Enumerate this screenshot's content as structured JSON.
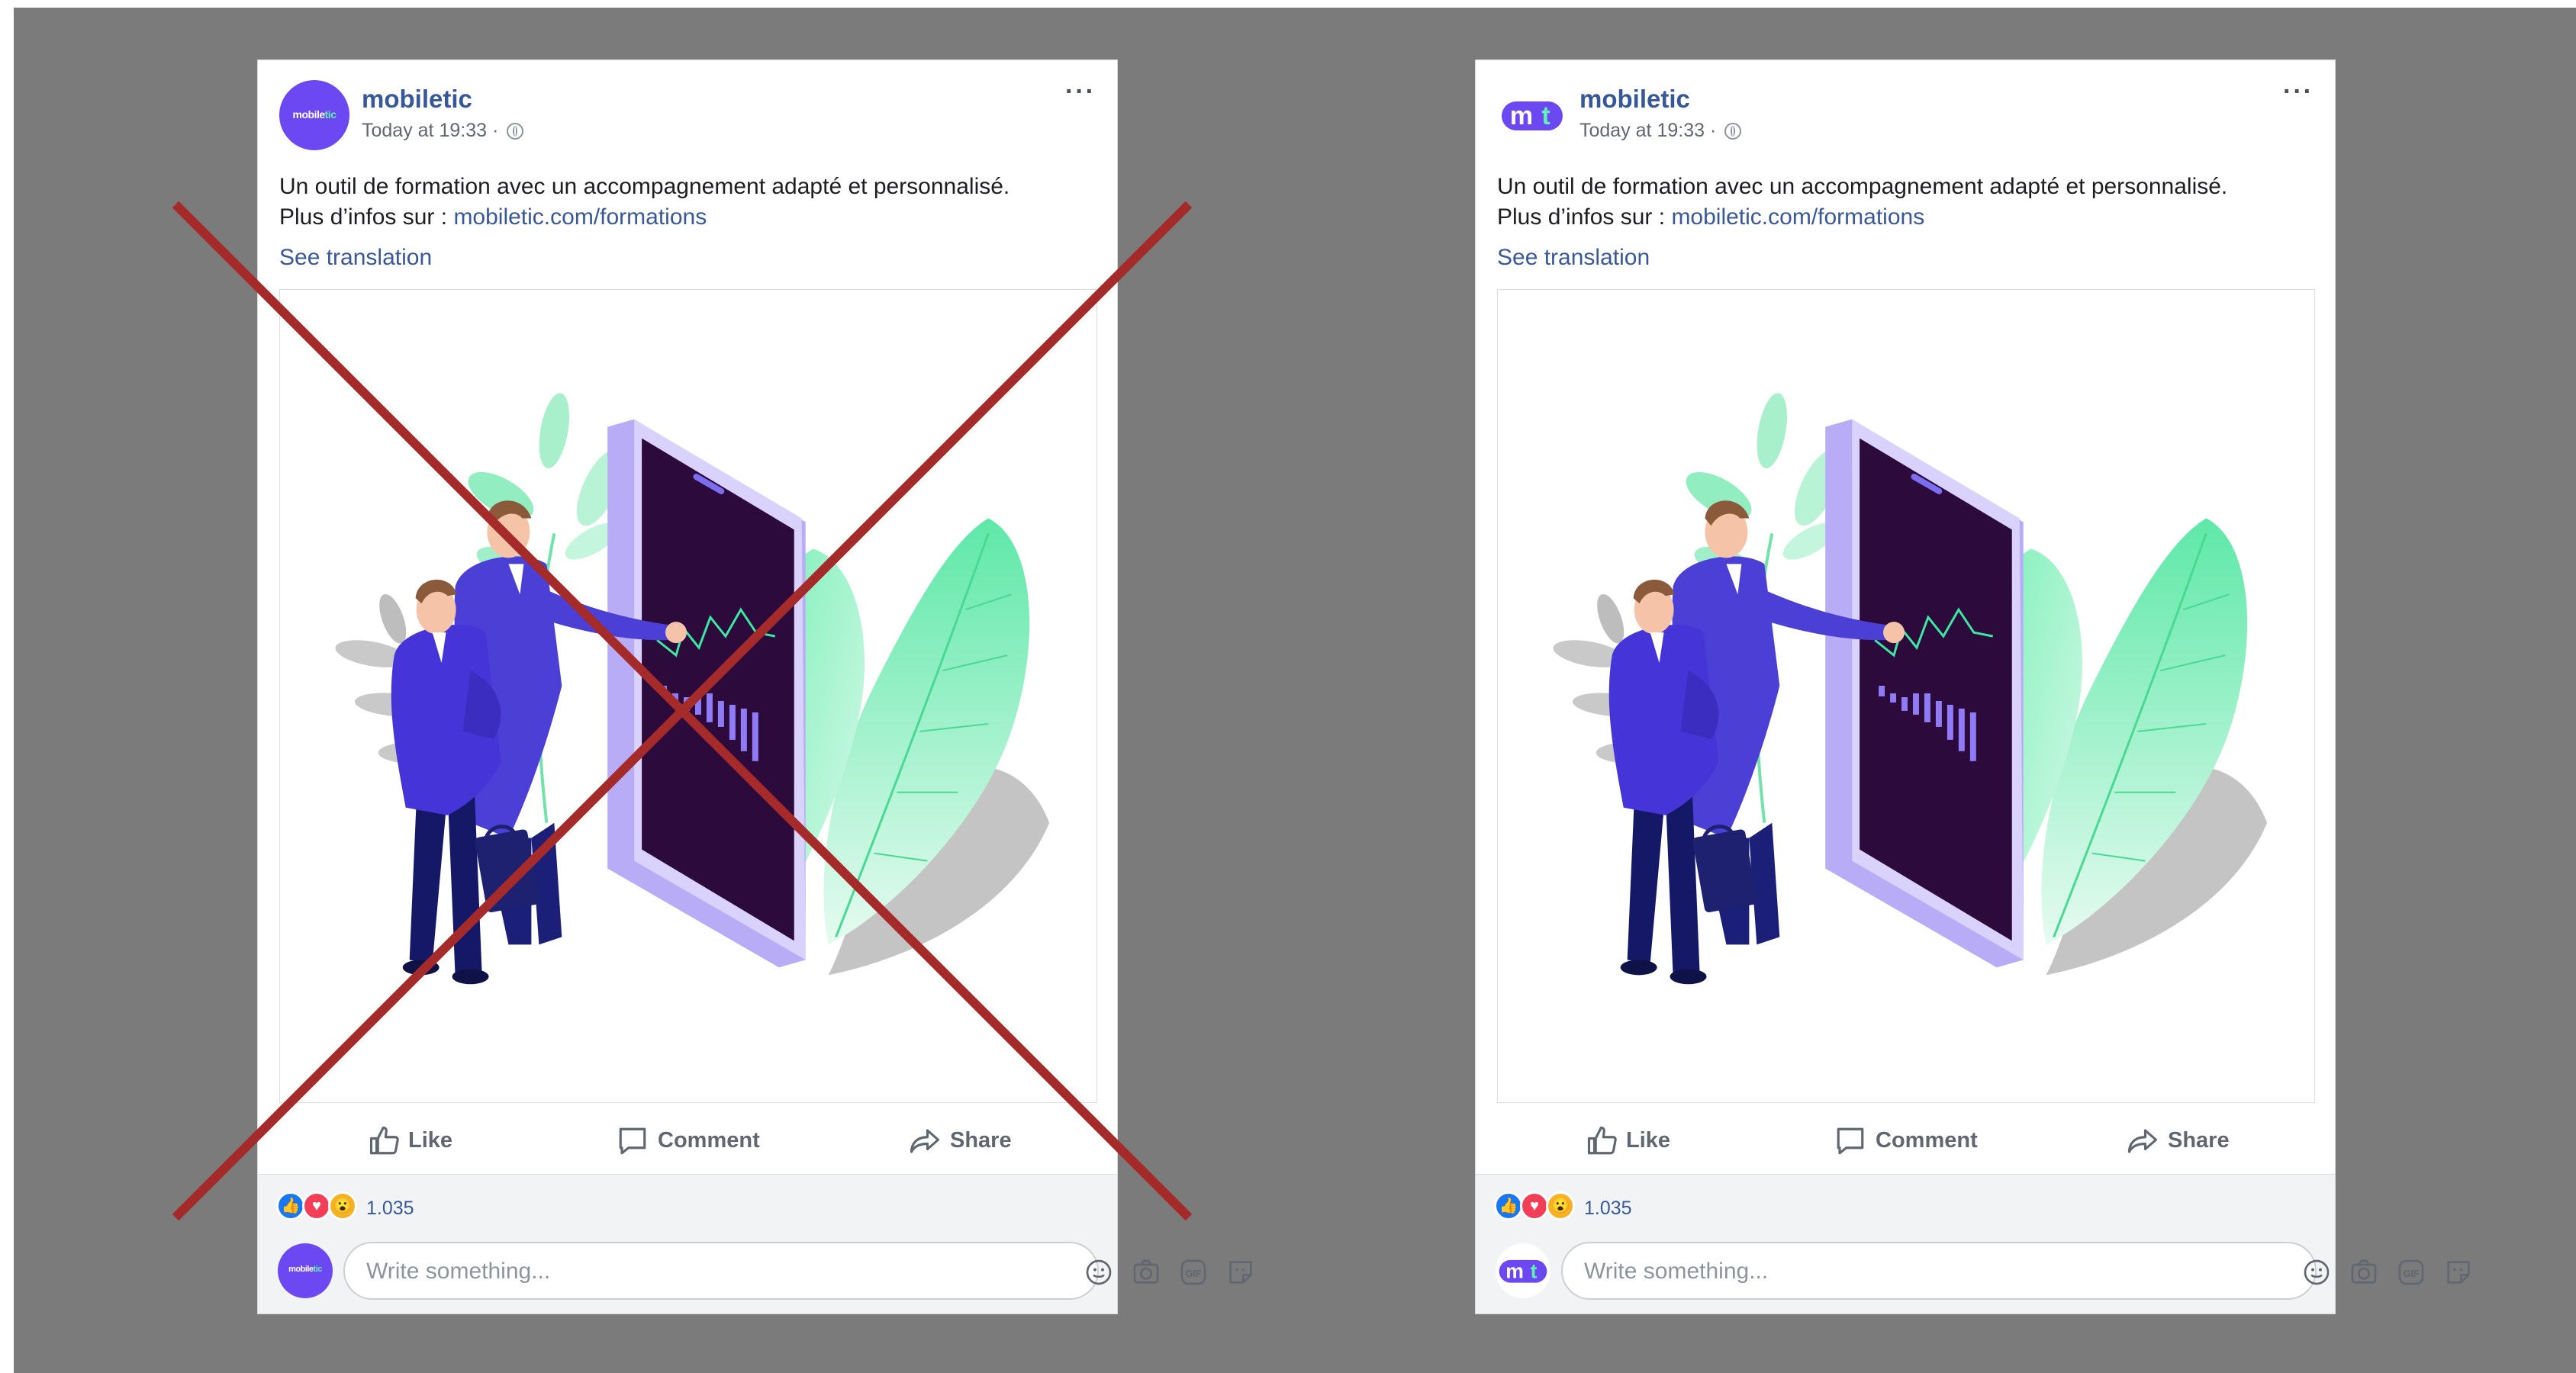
{
  "colors": {
    "background": "#7b7b7b",
    "facebook_link": "#385898",
    "page_name": "#365899",
    "brand_purple": "#6b48f2",
    "brand_green": "#63f0b3",
    "cross": "#a52a2a"
  },
  "posts": [
    {
      "variant": "incorrect",
      "page_name": "mobiletic",
      "avatar_text_a": "mobile",
      "avatar_text_b": "tic",
      "timestamp": "Today at 19:33 ·",
      "more_label": "···",
      "text_line1": "Un outil de formation avec un accompagnement adapté et personnalisé.",
      "text_line2_prefix": "Plus d’infos sur : ",
      "link": "mobiletic.com/formations",
      "see_translation": "See translation",
      "like_label": "Like",
      "comment_label": "Comment",
      "share_label": "Share",
      "reaction_count": "1.035",
      "comment_placeholder": "Write something...",
      "icons": [
        "globe-icon",
        "like-icon",
        "comment-icon",
        "share-icon",
        "emoji-icon",
        "camera-icon",
        "gif-icon",
        "sticker-icon"
      ],
      "crossed_out": true
    },
    {
      "variant": "correct",
      "page_name": "mobiletic",
      "avatar_letters_a": "m",
      "avatar_letters_b": "t",
      "timestamp": "Today at 19:33 ·",
      "more_label": "···",
      "text_line1": "Un outil de formation avec un accompagnement adapté et personnalisé.",
      "text_line2_prefix": "Plus d’infos sur : ",
      "link": "mobiletic.com/formations",
      "see_translation": "See translation",
      "like_label": "Like",
      "comment_label": "Comment",
      "share_label": "Share",
      "reaction_count": "1.035",
      "comment_placeholder": "Write something...",
      "icons": [
        "globe-icon",
        "like-icon",
        "comment-icon",
        "share-icon",
        "emoji-icon",
        "camera-icon",
        "gif-icon",
        "sticker-icon"
      ],
      "crossed_out": false
    }
  ],
  "reactions": [
    "like-reaction-icon",
    "love-reaction-icon",
    "wow-reaction-icon"
  ],
  "reaction_glyphs": {
    "like": "👍",
    "love": "♥",
    "wow": "😮"
  },
  "gif_label": "GIF"
}
